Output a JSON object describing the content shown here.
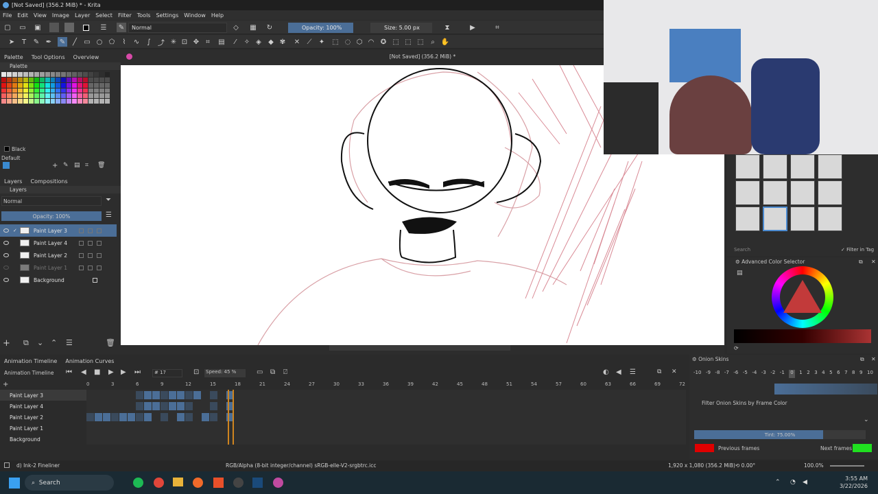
{
  "window": {
    "title": "[Not Saved]  (356.2 MiB) * - Krita"
  },
  "menu": [
    "File",
    "Edit",
    "View",
    "Image",
    "Layer",
    "Select",
    "Filter",
    "Tools",
    "Settings",
    "Window",
    "Help"
  ],
  "toolbar": {
    "blend_mode": "Normal",
    "opacity": "Opacity: 100%",
    "size": "Size: 5.00 px"
  },
  "left_dock": {
    "tabs": [
      "Palette",
      "Tool Options",
      "Overview"
    ],
    "palette_header": "Palette",
    "current_color": "Black",
    "palette_name": "Default",
    "layers_tabs": [
      "Layers",
      "Compositions"
    ],
    "layers_header": "Layers",
    "layer_blend": "Normal",
    "layer_opacity": "Opacity:  100%",
    "layers": [
      {
        "name": "Paint Layer 3",
        "selected": true
      },
      {
        "name": "Paint Layer 4",
        "selected": false
      },
      {
        "name": "Paint Layer 2",
        "selected": false
      },
      {
        "name": "Paint Layer 1",
        "selected": false
      },
      {
        "name": "Background",
        "selected": false
      }
    ]
  },
  "canvas": {
    "tab_title": "[Not Saved]  (356.2 MiB) *"
  },
  "brushes": {
    "search_placeholder": "Search",
    "filter_label": "Filter in Tag"
  },
  "color_selector": {
    "title": "Advanced Color Selector"
  },
  "timeline": {
    "tabs": [
      "Animation Timeline",
      "Animation Curves"
    ],
    "header": "Animation Timeline",
    "frame": "# 17",
    "speed": "Speed: 45 %",
    "ticks": [
      "0",
      "3",
      "6",
      "9",
      "12",
      "15",
      "18",
      "21",
      "24",
      "27",
      "30",
      "33",
      "36",
      "39",
      "42",
      "45",
      "48",
      "51",
      "54",
      "57",
      "60",
      "63",
      "66",
      "69",
      "72"
    ],
    "layers": [
      "Paint Layer 3",
      "Paint Layer 4",
      "Paint Layer 2",
      "Paint Layer 1",
      "Background"
    ]
  },
  "onion": {
    "title": "Onion Skins",
    "numbers": [
      "-10",
      "-9",
      "-8",
      "-7",
      "-6",
      "-5",
      "-4",
      "-3",
      "-2",
      "-1",
      "0",
      "1",
      "2",
      "3",
      "4",
      "5",
      "6",
      "7",
      "8",
      "9",
      "10"
    ],
    "filter_label": "Filter Onion Skins by Frame Color",
    "tint": "Tint: 75.00%",
    "tint_value": 0.75,
    "previous_label": "Previous frames",
    "next_label": "Next frames",
    "previous_color": "#e00000",
    "next_color": "#20e020"
  },
  "status": {
    "brush": "d) Ink-2 Fineliner",
    "color_space": "RGB/Alpha (8-bit integer/channel)  sRGB-elle-V2-srgbtrc.icc",
    "dimensions": "1,920 x 1,080 (356.2 MiB)",
    "rotation": "0.00°",
    "zoom": "100.0%"
  },
  "taskbar": {
    "search": "Search",
    "time": "3:55 AM",
    "date": "3/22/2026"
  }
}
